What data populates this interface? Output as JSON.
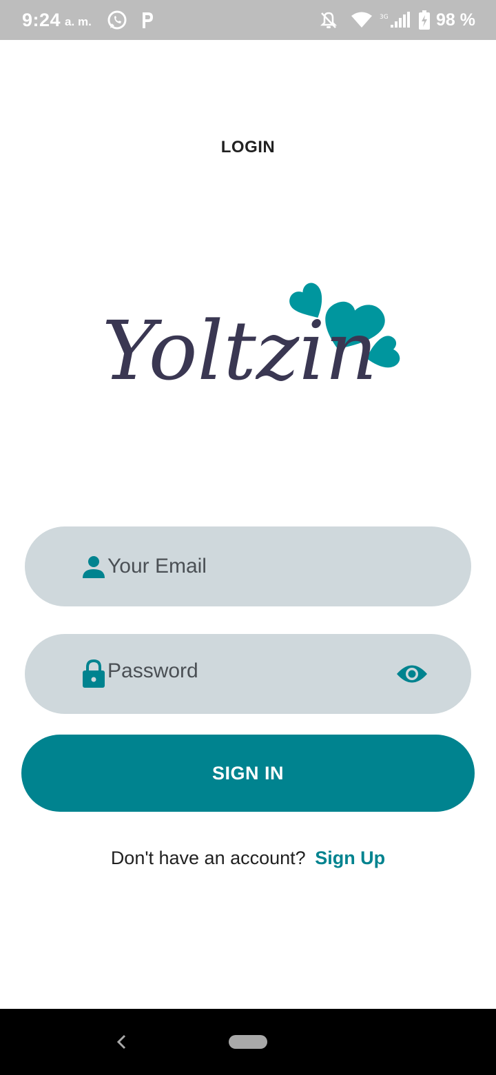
{
  "status_bar": {
    "time": "9:24",
    "ampm": "a. m.",
    "battery": "98 %",
    "icons": [
      "whatsapp-icon",
      "parking-app-icon",
      "notifications-off-icon",
      "wifi-icon",
      "signal-3g-icon",
      "battery-charging-icon"
    ]
  },
  "header": {
    "title": "LOGIN"
  },
  "logo": {
    "text": "Yoltzin",
    "text_color": "#3a3752",
    "heart_color": "#00969e"
  },
  "form": {
    "email_placeholder": "Your Email",
    "email_value": "",
    "password_placeholder": "Password",
    "password_value": "",
    "sign_in_label": "SIGN IN"
  },
  "signup": {
    "prompt": "Don't have an account?",
    "link": "Sign Up"
  },
  "colors": {
    "accent": "#00838f",
    "field_bg": "#cfd8dc",
    "status_bar_bg": "#bdbdbd"
  }
}
